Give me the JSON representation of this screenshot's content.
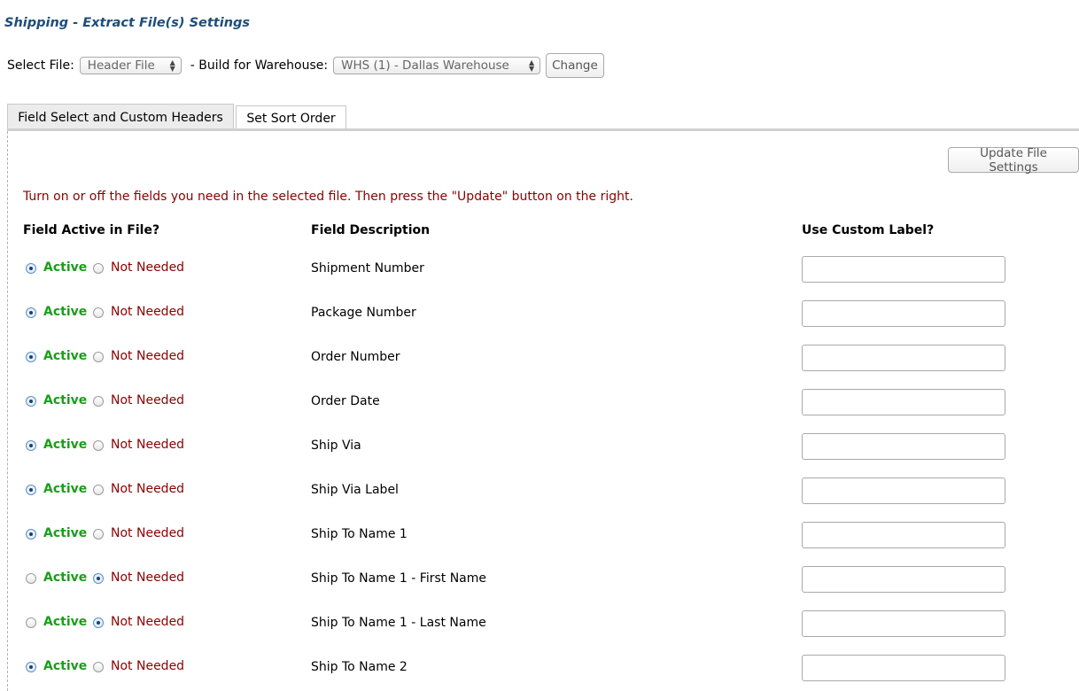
{
  "page": {
    "title": "Shipping - Extract File(s) Settings"
  },
  "file_bar": {
    "select_file_label": "Select File:",
    "select_file_value": "Header File",
    "warehouse_label": "- Build for Warehouse:",
    "warehouse_value": "WHS (1) - Dallas Warehouse",
    "change_label": "Change"
  },
  "tabs": [
    {
      "label": "Field Select and Custom Headers",
      "active": true
    },
    {
      "label": "Set Sort Order",
      "active": false
    }
  ],
  "update_button": "Update File Settings",
  "instruction": "Turn on or off the fields you need in the selected file.  Then press the \"Update\" button on the right.",
  "columns": {
    "active": "Field Active in File?",
    "description": "Field Description",
    "custom": "Use Custom Label?"
  },
  "option_labels": {
    "active": "Active",
    "not_needed": "Not Needed"
  },
  "fields": [
    {
      "description": "Shipment Number",
      "active": true,
      "custom_label": ""
    },
    {
      "description": "Package Number",
      "active": true,
      "custom_label": ""
    },
    {
      "description": "Order Number",
      "active": true,
      "custom_label": ""
    },
    {
      "description": "Order Date",
      "active": true,
      "custom_label": ""
    },
    {
      "description": "Ship Via",
      "active": true,
      "custom_label": ""
    },
    {
      "description": "Ship Via Label",
      "active": true,
      "custom_label": ""
    },
    {
      "description": "Ship To Name 1",
      "active": true,
      "custom_label": ""
    },
    {
      "description": "Ship To Name 1 - First Name",
      "active": false,
      "custom_label": ""
    },
    {
      "description": "Ship To Name 1 - Last Name",
      "active": false,
      "custom_label": ""
    },
    {
      "description": "Ship To Name 2",
      "active": true,
      "custom_label": ""
    }
  ]
}
